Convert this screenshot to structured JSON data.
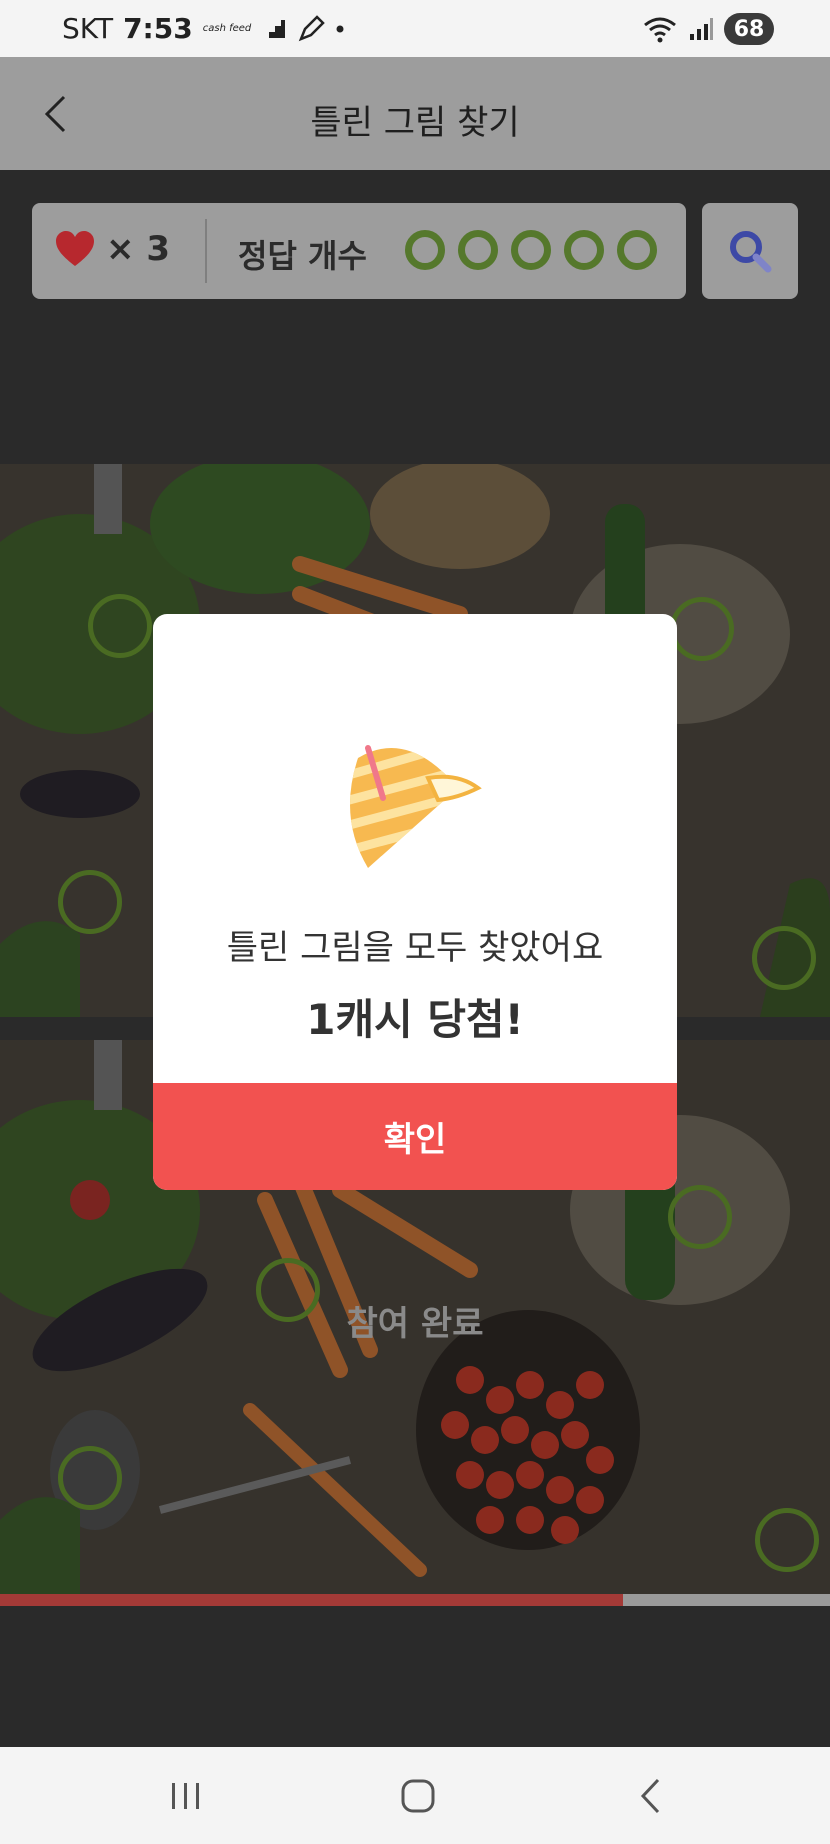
{
  "status_bar": {
    "carrier": "SKT",
    "time": "7:53",
    "app_badge": "cash feed",
    "battery": "68"
  },
  "header": {
    "title": "틀린 그림 찾기"
  },
  "game_bar": {
    "lives_label": "× 3",
    "answer_label": "정답 개수",
    "found_count": 5,
    "total_count": 5
  },
  "game": {
    "participation_text": "참여 완료",
    "progress_fraction": 0.75
  },
  "dialog": {
    "message": "틀린 그림을 모두 찾았어요",
    "reward": "1캐시 당첨!",
    "confirm_label": "확인",
    "icon": "party-popper-icon"
  },
  "colors": {
    "accent_red": "#f25250",
    "found_green": "#55782c",
    "heart": "#b7282e",
    "search_icon": "#3d49a6"
  },
  "nav": {
    "recents_icon": "recents-icon",
    "home_icon": "home-icon",
    "back_icon": "back-icon"
  }
}
